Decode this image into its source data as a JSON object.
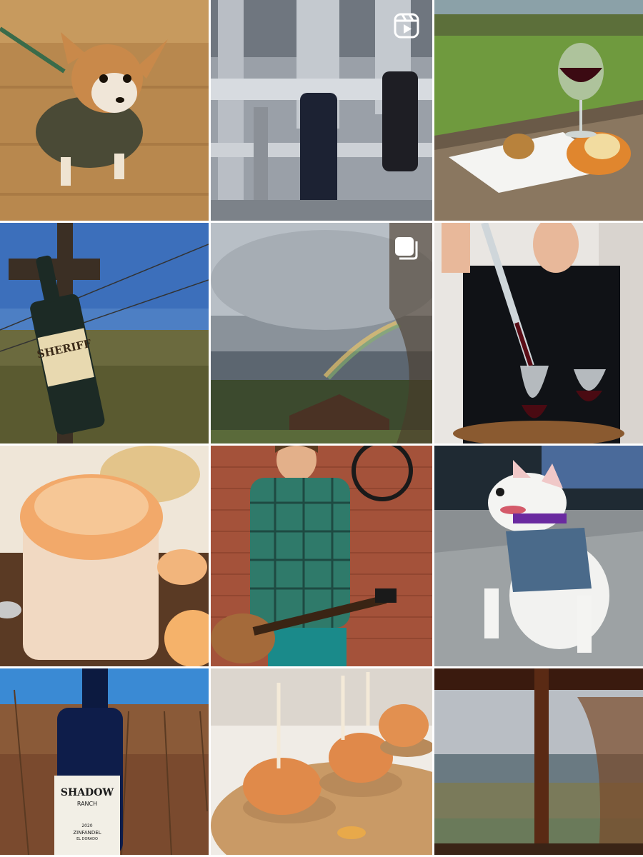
{
  "feed": {
    "posts": [
      {
        "id": "dog-jacket",
        "icon": null
      },
      {
        "id": "bottling-line",
        "icon": "reel-icon"
      },
      {
        "id": "wine-tasting-patio",
        "icon": null
      },
      {
        "id": "sheriff-bottle-vineyard",
        "icon": null
      },
      {
        "id": "storm-rainbow",
        "icon": "carousel-icon"
      },
      {
        "id": "wine-pour-aerator",
        "icon": null
      },
      {
        "id": "pimento-cheese-jar",
        "icon": null
      },
      {
        "id": "guitar-musician",
        "icon": null
      },
      {
        "id": "bull-terrier-dog",
        "icon": null
      },
      {
        "id": "shadow-ranch-bottle",
        "icon": null
      },
      {
        "id": "fried-chicken-bites",
        "icon": null
      },
      {
        "id": "window-vineyard-view",
        "icon": null
      }
    ]
  },
  "labels": {
    "sheriff": "SHERIFF",
    "shadow_ranch_line1": "SHADOW",
    "shadow_ranch_line2": "RANCH",
    "shadow_ranch_year": "2020",
    "shadow_ranch_varietal": "ZINFANDEL",
    "shadow_ranch_region": "EL DORADO"
  },
  "colors": {
    "background": "#ffffff",
    "badge": "#ffffff"
  }
}
